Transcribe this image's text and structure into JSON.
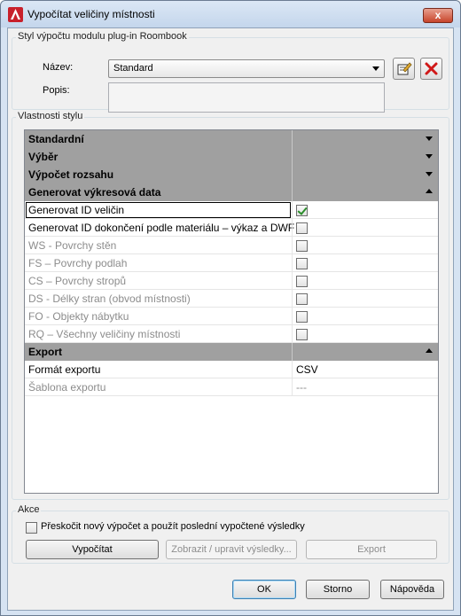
{
  "window": {
    "title": "Vypočítat veličiny místnosti",
    "close_label": "x"
  },
  "style_group": {
    "label": "Styl výpočtu modulu plug-in Roombook",
    "name_label": "Název:",
    "name_value": "Standard",
    "desc_label": "Popis:",
    "desc_value": ""
  },
  "properties_group": {
    "label": "Vlastnosti stylu",
    "categories": [
      {
        "label": "Standardní",
        "state": "collapsed"
      },
      {
        "label": "Výběr",
        "state": "collapsed"
      },
      {
        "label": "Výpočet rozsahu",
        "state": "collapsed"
      },
      {
        "label": "Generovat výkresová data",
        "state": "expanded",
        "props": [
          {
            "label": "Generovat ID veličin",
            "checked": true,
            "disabled": false
          },
          {
            "label": "Generovat ID dokončení podle materiálu – výkaz a DWF",
            "checked": false,
            "disabled": false
          },
          {
            "label": "WS - Povrchy stěn",
            "checked": false,
            "disabled": true
          },
          {
            "label": "FS – Povrchy podlah",
            "checked": false,
            "disabled": true
          },
          {
            "label": "CS – Povrchy stropů",
            "checked": false,
            "disabled": true
          },
          {
            "label": "DS - Délky stran (obvod místnosti)",
            "checked": false,
            "disabled": true
          },
          {
            "label": "FO - Objekty nábytku",
            "checked": false,
            "disabled": true
          },
          {
            "label": "RQ – Všechny veličiny místnosti",
            "checked": false,
            "disabled": true
          }
        ]
      },
      {
        "label": "Export",
        "state": "expanded",
        "props": [
          {
            "label": "Formát exportu",
            "value": "CSV",
            "disabled": false
          },
          {
            "label": "Šablona exportu",
            "value": "---",
            "disabled": true
          }
        ]
      }
    ]
  },
  "actions_group": {
    "label": "Akce",
    "skip_checkbox_label": "Přeskočit nový výpočet a použít poslední vypočtené výsledky",
    "skip_checked": false,
    "calculate_label": "Vypočítat",
    "view_label": "Zobrazit / upravit výsledky...",
    "export_label": "Export"
  },
  "footer": {
    "ok_label": "OK",
    "cancel_label": "Storno",
    "help_label": "Nápověda"
  }
}
